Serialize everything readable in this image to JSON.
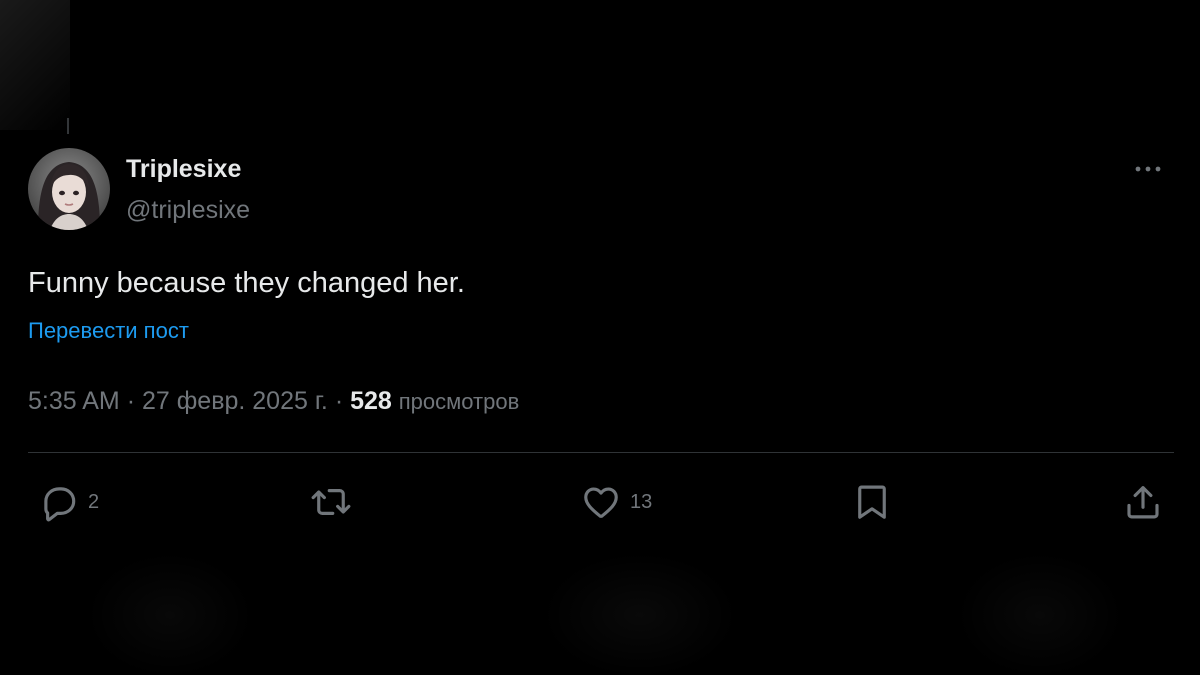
{
  "tweet": {
    "author": {
      "display_name": "Triplesixe",
      "handle": "@triplesixe"
    },
    "text": "Funny because they changed her.",
    "translate_label": "Перевести пост",
    "time": "5:35 AM",
    "separator": "·",
    "date": "27 февр. 2025 г.",
    "views_count": "528",
    "views_label": "просмотров"
  },
  "actions": {
    "reply_count": "2",
    "like_count": "13"
  },
  "icons": {
    "more": "more-horizontal-icon",
    "reply": "reply-icon",
    "retweet": "retweet-icon",
    "like": "heart-icon",
    "bookmark": "bookmark-icon",
    "share": "share-icon"
  },
  "colors": {
    "background": "#000000",
    "text_primary": "#e7e9ea",
    "text_secondary": "#71767b",
    "link": "#1d9bf0",
    "divider": "#2f3336"
  }
}
